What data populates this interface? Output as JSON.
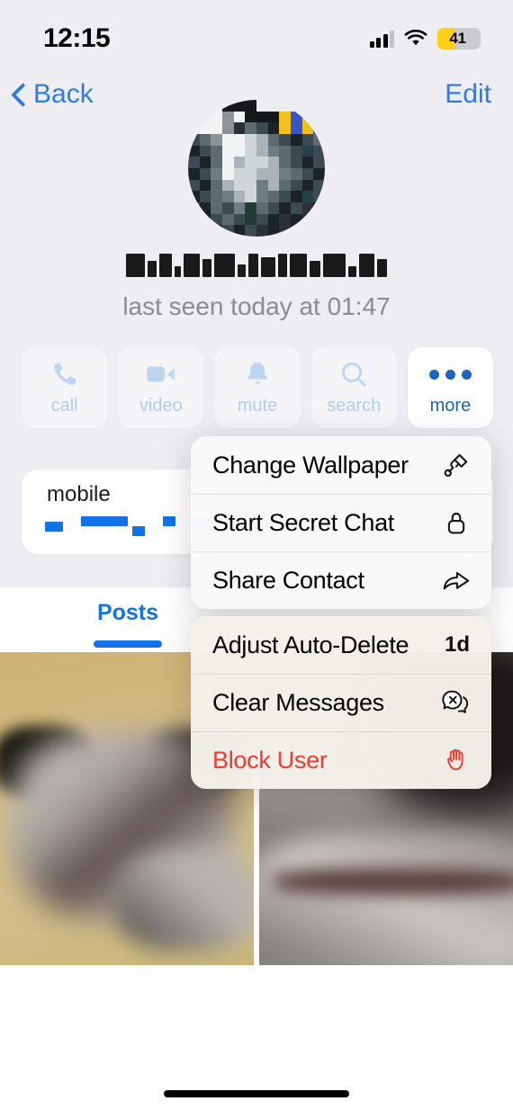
{
  "status_bar": {
    "time": "12:15",
    "battery_level": "41",
    "battery_percent": 41,
    "battery_color": "#fdd015",
    "signal_icon": "cellular-bars-icon",
    "wifi_icon": "wifi-icon"
  },
  "nav": {
    "back_label": "Back",
    "edit_label": "Edit",
    "back_icon": "chevron-left-icon",
    "accent_color": "#2f7ce0"
  },
  "profile": {
    "avatar_icon": "user-avatar-pixelated",
    "name": "",
    "name_redacted": true,
    "last_seen": "last seen today at 01:47"
  },
  "actions": [
    {
      "label": "call",
      "icon": "phone-icon",
      "state": "dimmed"
    },
    {
      "label": "video",
      "icon": "video-icon",
      "state": "dimmed"
    },
    {
      "label": "mute",
      "icon": "bell-icon",
      "state": "dimmed"
    },
    {
      "label": "search",
      "icon": "search-icon",
      "state": "dimmed"
    },
    {
      "label": "more",
      "icon": "ellipsis-icon",
      "state": "active"
    }
  ],
  "info": {
    "phone_label": "mobile",
    "phone_value": "",
    "phone_redacted": true,
    "value_color": "#1272e8"
  },
  "tabs": [
    {
      "label": "Posts",
      "selected": true
    }
  ],
  "posts": [
    {
      "name": "post-thumbnail-1",
      "blurred": true
    },
    {
      "name": "post-thumbnail-2",
      "blurred": true
    }
  ],
  "context_menu": {
    "groups": [
      {
        "items": [
          {
            "label": "Change Wallpaper",
            "icon": "paintbrush-icon",
            "value": "",
            "danger": false
          },
          {
            "label": "Start Secret Chat",
            "icon": "lock-icon",
            "value": "",
            "danger": false
          },
          {
            "label": "Share Contact",
            "icon": "share-arrow-icon",
            "value": "",
            "danger": false
          }
        ]
      },
      {
        "items": [
          {
            "label": "Adjust Auto-Delete",
            "icon": "",
            "value": "1d",
            "danger": false
          },
          {
            "label": "Clear Messages",
            "icon": "chat-bubble-x-icon",
            "value": "",
            "danger": false
          },
          {
            "label": "Block User",
            "icon": "stop-hand-icon",
            "value": "",
            "danger": true
          }
        ]
      }
    ],
    "danger_color": "#ef3b30"
  },
  "home_indicator": "home-indicator"
}
